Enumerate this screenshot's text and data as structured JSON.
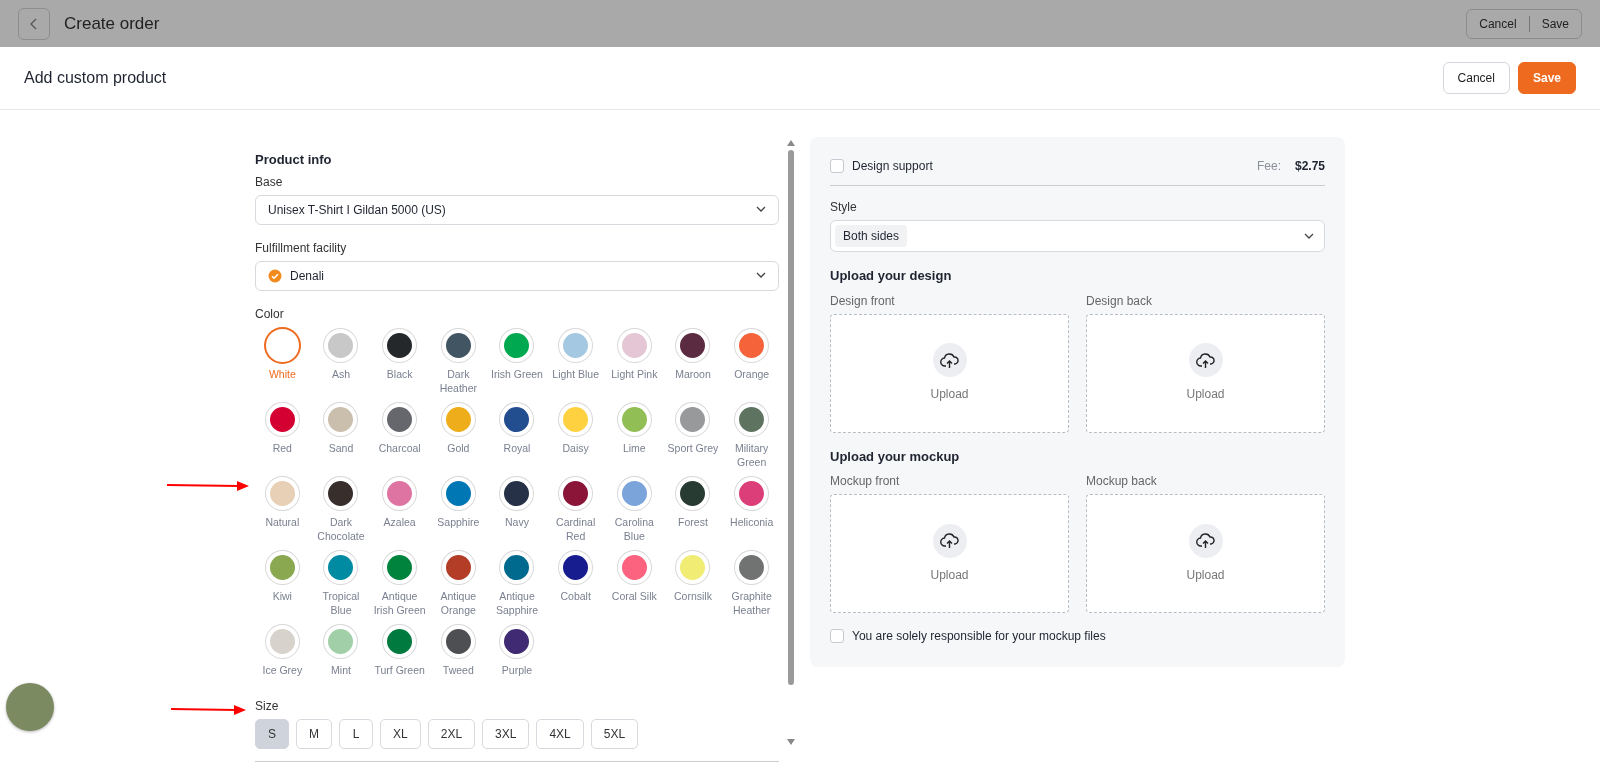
{
  "background_page": {
    "title": "Create order",
    "buttons": [
      "Cancel",
      "Save"
    ]
  },
  "modal": {
    "title": "Add custom product",
    "cancel": "Cancel",
    "save": "Save"
  },
  "product_info": {
    "title": "Product info",
    "base_label": "Base",
    "base_value": "Unisex T-Shirt I Gildan 5000 (US)",
    "facility_label": "Fulfillment facility",
    "facility_value": "Denali",
    "color_label": "Color",
    "colors": [
      {
        "name": "White",
        "color": "#ffffff",
        "selected": true
      },
      {
        "name": "Ash",
        "color": "#c8c8c8",
        "selected": false
      },
      {
        "name": "Black",
        "color": "#25282a",
        "selected": false
      },
      {
        "name": "Dark Heather",
        "color": "#425563",
        "selected": false
      },
      {
        "name": "Irish Green",
        "color": "#00a94f",
        "selected": false
      },
      {
        "name": "Light Blue",
        "color": "#a4c8e1",
        "selected": false
      },
      {
        "name": "Light Pink",
        "color": "#e4c6d4",
        "selected": false
      },
      {
        "name": "Maroon",
        "color": "#5b2b42",
        "selected": false
      },
      {
        "name": "Orange",
        "color": "#f4633a",
        "selected": false
      },
      {
        "name": "Red",
        "color": "#d50032",
        "selected": false
      },
      {
        "name": "Sand",
        "color": "#cabfad",
        "selected": false
      },
      {
        "name": "Charcoal",
        "color": "#66676c",
        "selected": false
      },
      {
        "name": "Gold",
        "color": "#eead1a",
        "selected": false
      },
      {
        "name": "Royal",
        "color": "#224d8f",
        "selected": false
      },
      {
        "name": "Daisy",
        "color": "#fed141",
        "selected": false
      },
      {
        "name": "Lime",
        "color": "#92bf55",
        "selected": false
      },
      {
        "name": "Sport Grey",
        "color": "#97999b",
        "selected": false
      },
      {
        "name": "Military Green",
        "color": "#5e7461",
        "selected": false
      },
      {
        "name": "Natural",
        "color": "#e8d0b7",
        "selected": false
      },
      {
        "name": "Dark Chocolate",
        "color": "#382f2d",
        "selected": false
      },
      {
        "name": "Azalea",
        "color": "#dd74a1",
        "selected": false
      },
      {
        "name": "Sapphire",
        "color": "#0077b5",
        "selected": false
      },
      {
        "name": "Navy",
        "color": "#263147",
        "selected": false
      },
      {
        "name": "Cardinal Red",
        "color": "#8a1538",
        "selected": false
      },
      {
        "name": "Carolina Blue",
        "color": "#7ba4db",
        "selected": false
      },
      {
        "name": "Forest",
        "color": "#273b33",
        "selected": false
      },
      {
        "name": "Heliconia",
        "color": "#db3e79",
        "selected": false
      },
      {
        "name": "Kiwi",
        "color": "#89a84f",
        "selected": false
      },
      {
        "name": "Tropical Blue",
        "color": "#008ba3",
        "selected": false
      },
      {
        "name": "Antique Irish Green",
        "color": "#00843d",
        "selected": false
      },
      {
        "name": "Antique Orange",
        "color": "#b33d26",
        "selected": false
      },
      {
        "name": "Antique Sapphire",
        "color": "#006a8e",
        "selected": false
      },
      {
        "name": "Cobalt",
        "color": "#171c8f",
        "selected": false
      },
      {
        "name": "Coral Silk",
        "color": "#fb637e",
        "selected": false
      },
      {
        "name": "Cornsilk",
        "color": "#f0ec74",
        "selected": false
      },
      {
        "name": "Graphite Heather",
        "color": "#707372",
        "selected": false
      },
      {
        "name": "Ice Grey",
        "color": "#d7d2cb",
        "selected": false
      },
      {
        "name": "Mint",
        "color": "#a0cfa8",
        "selected": false
      },
      {
        "name": "Turf Green",
        "color": "#007a3e",
        "selected": false
      },
      {
        "name": "Tweed",
        "color": "#4d4f53",
        "selected": false
      },
      {
        "name": "Purple",
        "color": "#3f2a73",
        "selected": false
      }
    ],
    "size_label": "Size",
    "sizes": [
      {
        "label": "S",
        "selected": true
      },
      {
        "label": "M",
        "selected": false
      },
      {
        "label": "L",
        "selected": false
      },
      {
        "label": "XL",
        "selected": false
      },
      {
        "label": "2XL",
        "selected": false
      },
      {
        "label": "3XL",
        "selected": false
      },
      {
        "label": "4XL",
        "selected": false
      },
      {
        "label": "5XL",
        "selected": false
      }
    ]
  },
  "design": {
    "design_support": {
      "label": "Design support",
      "checked": false
    },
    "fee_label": "Fee:",
    "fee_value": "$2.75",
    "style_label": "Style",
    "style_value": "Both sides",
    "sections": [
      {
        "title": "Upload your design",
        "slots": [
          {
            "label": "Design front",
            "action": "Upload"
          },
          {
            "label": "Design back",
            "action": "Upload"
          }
        ]
      },
      {
        "title": "Upload your mockup",
        "slots": [
          {
            "label": "Mockup front",
            "action": "Upload"
          },
          {
            "label": "Mockup back",
            "action": "Upload"
          }
        ]
      }
    ],
    "responsibility": {
      "label": "You are solely responsible for your mockup files",
      "checked": false
    }
  }
}
